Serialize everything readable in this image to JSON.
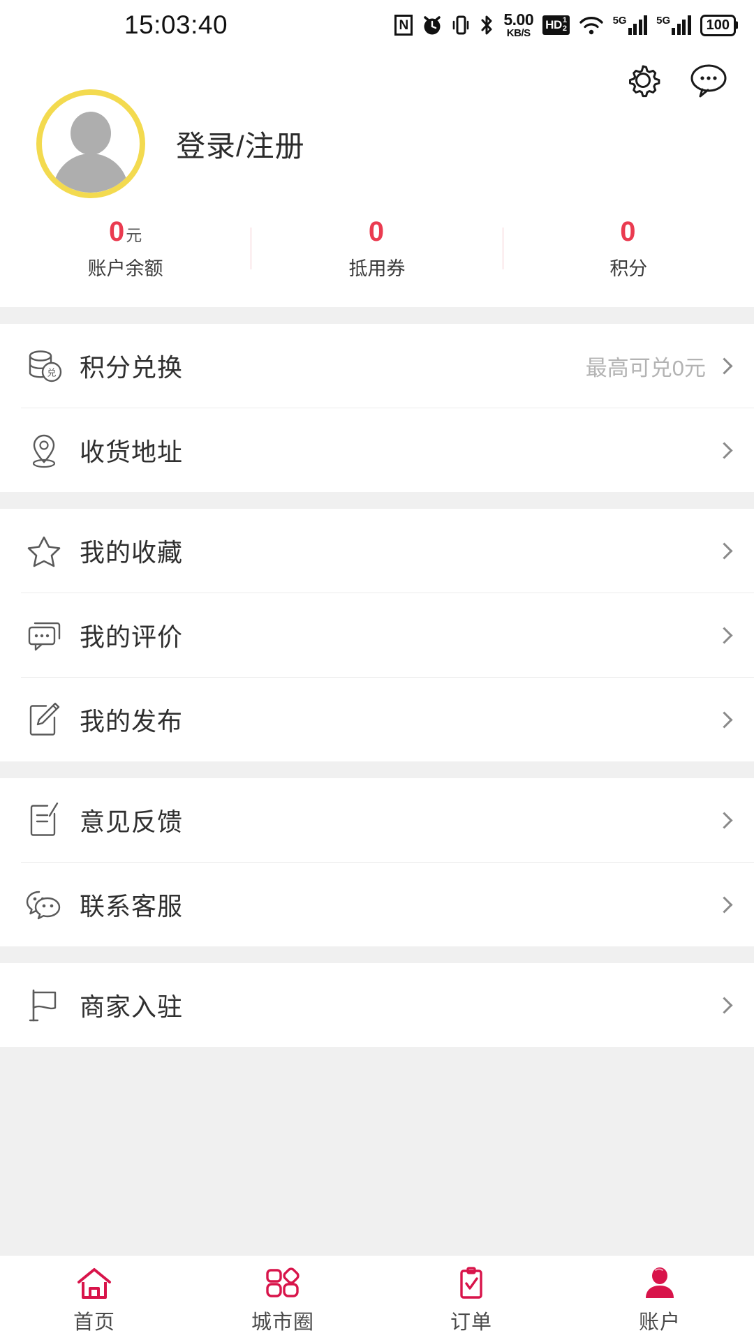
{
  "status_bar": {
    "time": "15:03:40",
    "nfc_label": "N",
    "net_speed_value": "5.00",
    "net_speed_unit": "KB/S",
    "hd_label_main": "HD",
    "hd_label_sub1": "1",
    "hd_label_sub2": "2",
    "signal1_tag": "5G",
    "signal2_tag": "5G",
    "battery": "100",
    "icons": [
      "nfc-icon",
      "alarm-icon",
      "vibrate-icon",
      "bluetooth-icon",
      "network-speed",
      "hd-voice-icon",
      "wifi-icon",
      "signal-5g-1",
      "signal-5g-2",
      "battery-icon"
    ]
  },
  "header": {
    "settings_icon": "gear-icon",
    "message_icon": "chat-bubble-icon",
    "avatar_icon": "default-avatar",
    "avatar_ring_color": "#f3da4f",
    "login_text": "登录/注册",
    "accent_color": "#ea3b50",
    "stats": [
      {
        "value": "0",
        "unit": "元",
        "label": "账户余额"
      },
      {
        "value": "0",
        "unit": "",
        "label": "抵用券"
      },
      {
        "value": "0",
        "unit": "",
        "label": "积分"
      }
    ]
  },
  "sections": [
    {
      "items": [
        {
          "icon": "points-exchange-icon",
          "label": "积分兑换",
          "hint": "最高可兑0元"
        },
        {
          "icon": "location-pin-icon",
          "label": "收货地址",
          "hint": ""
        }
      ]
    },
    {
      "items": [
        {
          "icon": "star-icon",
          "label": "我的收藏",
          "hint": ""
        },
        {
          "icon": "comment-icon",
          "label": "我的评价",
          "hint": ""
        },
        {
          "icon": "edit-square-icon",
          "label": "我的发布",
          "hint": ""
        }
      ]
    },
    {
      "items": [
        {
          "icon": "feedback-doc-icon",
          "label": "意见反馈",
          "hint": ""
        },
        {
          "icon": "wechat-bubbles-icon",
          "label": "联系客服",
          "hint": ""
        }
      ]
    },
    {
      "items": [
        {
          "icon": "flag-icon",
          "label": "商家入驻",
          "hint": ""
        }
      ]
    }
  ],
  "tabbar": {
    "active_index": 3,
    "active_color": "#d8144a",
    "items": [
      {
        "icon": "home-icon",
        "label": "首页"
      },
      {
        "icon": "city-circle-icon",
        "label": "城市圈"
      },
      {
        "icon": "order-clipboard-icon",
        "label": "订单"
      },
      {
        "icon": "account-person-icon",
        "label": "账户"
      }
    ]
  }
}
